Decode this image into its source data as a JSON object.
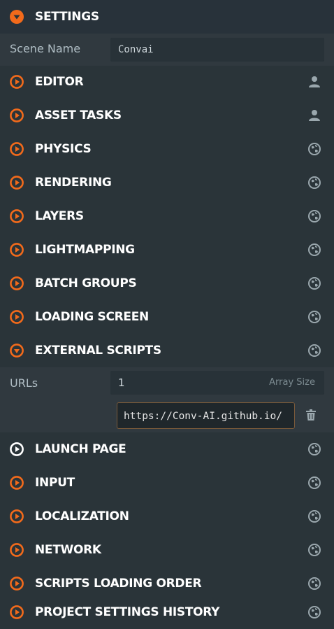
{
  "header": {
    "title": "SETTINGS",
    "icon": "chevron-down-circle-icon"
  },
  "scene": {
    "label": "Scene Name",
    "value": "Convai"
  },
  "sections_top": [
    {
      "label": "EDITOR",
      "icon": "user-icon"
    },
    {
      "label": "ASSET TASKS",
      "icon": "user-icon"
    },
    {
      "label": "PHYSICS",
      "icon": "globe-icon"
    },
    {
      "label": "RENDERING",
      "icon": "globe-icon"
    },
    {
      "label": "LAYERS",
      "icon": "globe-icon"
    },
    {
      "label": "LIGHTMAPPING",
      "icon": "globe-icon"
    },
    {
      "label": "BATCH GROUPS",
      "icon": "globe-icon"
    },
    {
      "label": "LOADING SCREEN",
      "icon": "globe-icon"
    },
    {
      "label": "EXTERNAL SCRIPTS",
      "icon": "globe-icon",
      "expanded": true
    }
  ],
  "external_scripts": {
    "urls_label": "URLs",
    "array_size_value": "1",
    "array_size_hint": "Array Size",
    "url_value": "https://Conv-AI.github.io/"
  },
  "sections_bottom": [
    {
      "label": "LAUNCH PAGE",
      "icon": "globe-icon"
    },
    {
      "label": "INPUT",
      "icon": "globe-icon"
    },
    {
      "label": "LOCALIZATION",
      "icon": "globe-icon"
    },
    {
      "label": "NETWORK",
      "icon": "globe-icon"
    },
    {
      "label": "SCRIPTS LOADING ORDER",
      "icon": "globe-icon"
    },
    {
      "label": "PROJECT SETTINGS HISTORY",
      "icon": "globe-icon"
    }
  ],
  "colors": {
    "accent": "#f26a1b",
    "background": "#2a3439",
    "subpanel": "#30393f",
    "icon": "#9aa7ad"
  }
}
